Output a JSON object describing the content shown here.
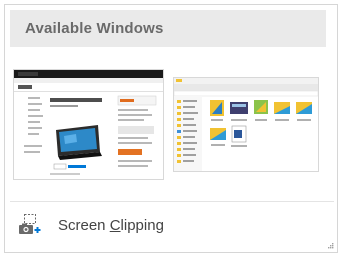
{
  "panel": {
    "header_title": "Available Windows",
    "thumbnails": [
      {
        "name": "browser-window-thumbnail"
      },
      {
        "name": "file-explorer-window-thumbnail"
      }
    ],
    "screen_clipping": {
      "label_before": "Screen ",
      "label_accel": "C",
      "label_after": "lipping",
      "icon": "camera-plus-icon"
    }
  },
  "colors": {
    "header_bg": "#eaeaea",
    "header_text": "#6a6a6a",
    "clip_text": "#444444",
    "accent_blue": "#0078d7"
  }
}
